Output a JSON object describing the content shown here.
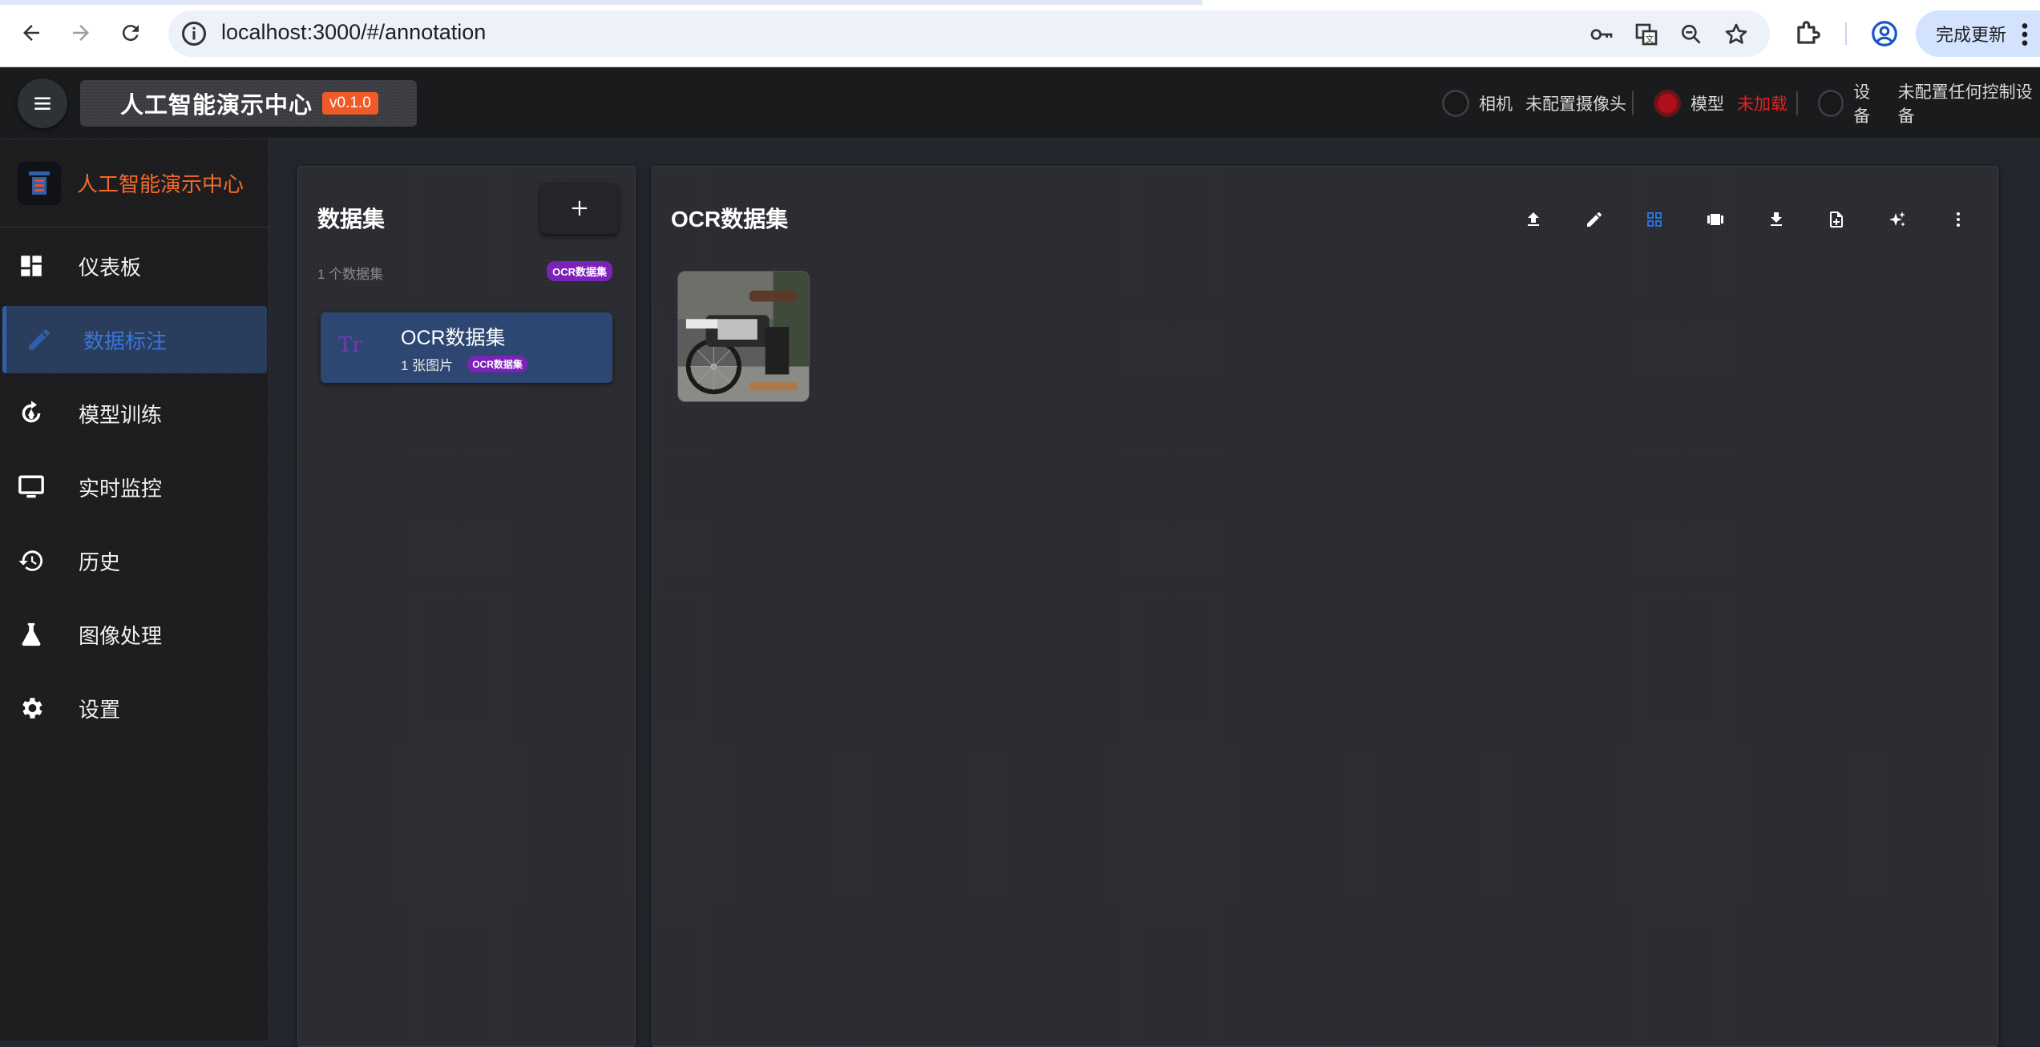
{
  "browser": {
    "url": "localhost:3000/#/annotation",
    "update_label": "完成更新"
  },
  "header": {
    "app_title": "人工智能演示中心",
    "version": "v0.1.0",
    "status": {
      "camera_label": "相机",
      "camera_value": "未配置摄像头",
      "model_label": "模型",
      "model_value": "未加载",
      "device_label": "设备",
      "device_value": "未配置任何控制设备"
    }
  },
  "sidebar": {
    "brand": "人工智能演示中心",
    "items": [
      {
        "label": "仪表板",
        "icon": "dashboard-icon"
      },
      {
        "label": "数据标注",
        "icon": "pencil-icon",
        "active": true
      },
      {
        "label": "模型训练",
        "icon": "training-icon"
      },
      {
        "label": "实时监控",
        "icon": "monitor-icon"
      },
      {
        "label": "历史",
        "icon": "history-icon"
      },
      {
        "label": "图像处理",
        "icon": "flask-icon"
      },
      {
        "label": "设置",
        "icon": "gear-icon"
      }
    ]
  },
  "datasets_panel": {
    "title": "数据集",
    "count_text": "1 个数据集",
    "type_badge": "OCR数据集",
    "items": [
      {
        "icon_text": "Tr",
        "name": "OCR数据集",
        "sub": "1 张图片",
        "badge": "OCR数据集"
      }
    ]
  },
  "main_panel": {
    "title": "OCR数据集",
    "toolbar": [
      "upload-icon",
      "edit-icon",
      "grid-view-icon",
      "carousel-view-icon",
      "download-icon",
      "add-file-icon",
      "sparkle-icon",
      "more-vert-icon"
    ],
    "active_tool": "grid-view-icon"
  },
  "colors": {
    "accent_orange": "#f36a2a",
    "active_blue": "#3b76d8",
    "badge_purple": "#7b22b8",
    "status_red": "#e62020"
  }
}
